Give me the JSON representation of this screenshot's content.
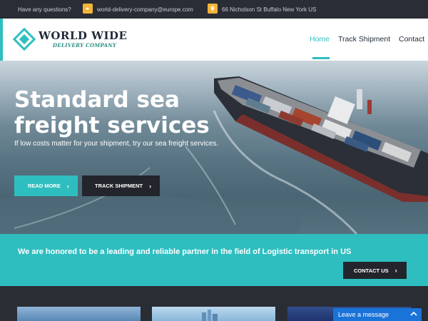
{
  "topbar": {
    "question": "Have any questions?",
    "email": "world-delivery-company@europe.com",
    "address": "66 Nicholson St Buffalo New York US"
  },
  "brand": {
    "title": "WORLD WIDE",
    "subtitle": "DELIVERY COMPANY"
  },
  "nav": [
    {
      "label": "Home",
      "active": true
    },
    {
      "label": "Track Shipment",
      "active": false
    },
    {
      "label": "Contact",
      "active": false
    }
  ],
  "hero": {
    "title": "Standard sea freight services",
    "subtitle": "If low costs matter for your shipment, try our sea freight services.",
    "read_more": "READ MORE",
    "track_shipment": "TRACK SHIPMENT"
  },
  "band": {
    "text": "We are honored to be a leading and reliable partner in the field of Logistic transport in US",
    "contact": "CONTACT US"
  },
  "chat": {
    "label": "Leave a message"
  },
  "colors": {
    "accent": "#2fbec0",
    "dark": "#22252b",
    "icon_yellow": "#f2b53a",
    "chat_blue": "#1a73d9"
  }
}
